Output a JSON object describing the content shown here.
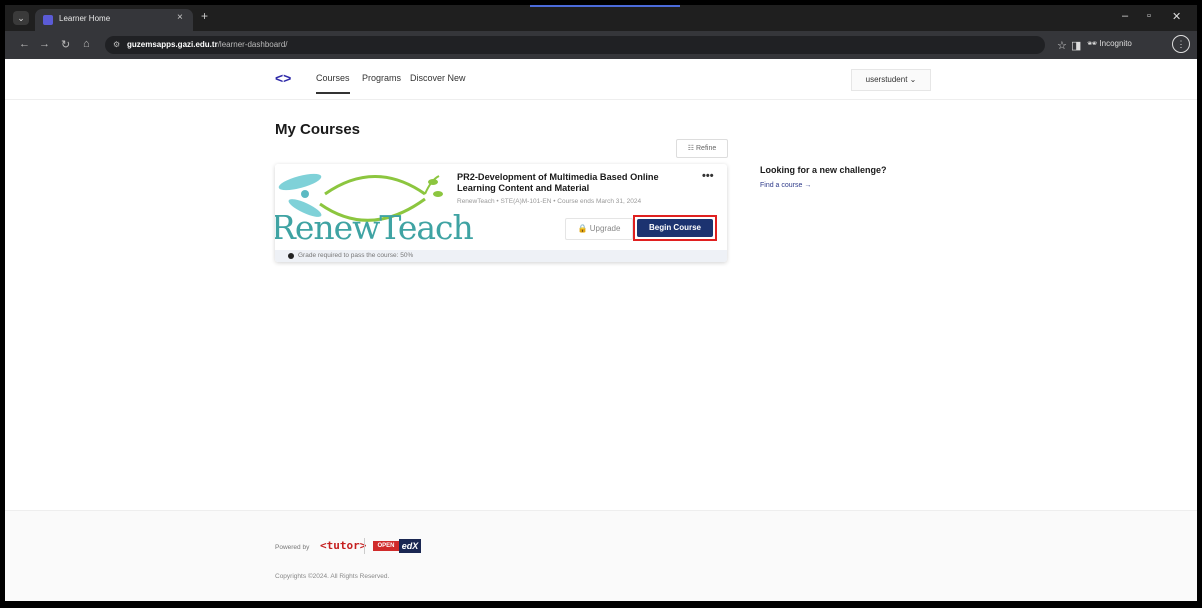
{
  "browser": {
    "tab_title": "Learner Home",
    "tab_close": "×",
    "new_tab": "+",
    "url_domain": "guzemsapps.gazi.edu.tr",
    "url_path": "/learner-dashboard/",
    "incognito_label": "Incognito",
    "minimize": "–",
    "restore": "▫",
    "close": "✕"
  },
  "header": {
    "nav": [
      "Courses",
      "Programs",
      "Discover New"
    ],
    "user_menu": "userstudent ⌄"
  },
  "main": {
    "title": "My Courses",
    "refine_label": "Refine"
  },
  "course_card": {
    "title": "PR2-Development of Multimedia Based Online Learning Content and Material",
    "meta": "RenewTeach • STE(A)M-101-EN • Course ends March 31, 2024",
    "image_text": "RenewTeach",
    "more": "•••",
    "upgrade_label": "Upgrade",
    "begin_label": "Begin Course",
    "grade_note": "Grade required to pass the course: 50%"
  },
  "sidebar": {
    "title": "Looking for a new challenge?",
    "link": "Find a course →"
  },
  "footer": {
    "powered_by": "Powered by",
    "tutor": "<tutor>",
    "openedx_left": "OPEN",
    "openedx_right": "edX",
    "copyright": "Copyrights ©2024. All Rights Reserved."
  },
  "colors": {
    "primary_button": "#1c3370",
    "highlight_outline": "#e02020",
    "logo": "#2f2aa8"
  }
}
